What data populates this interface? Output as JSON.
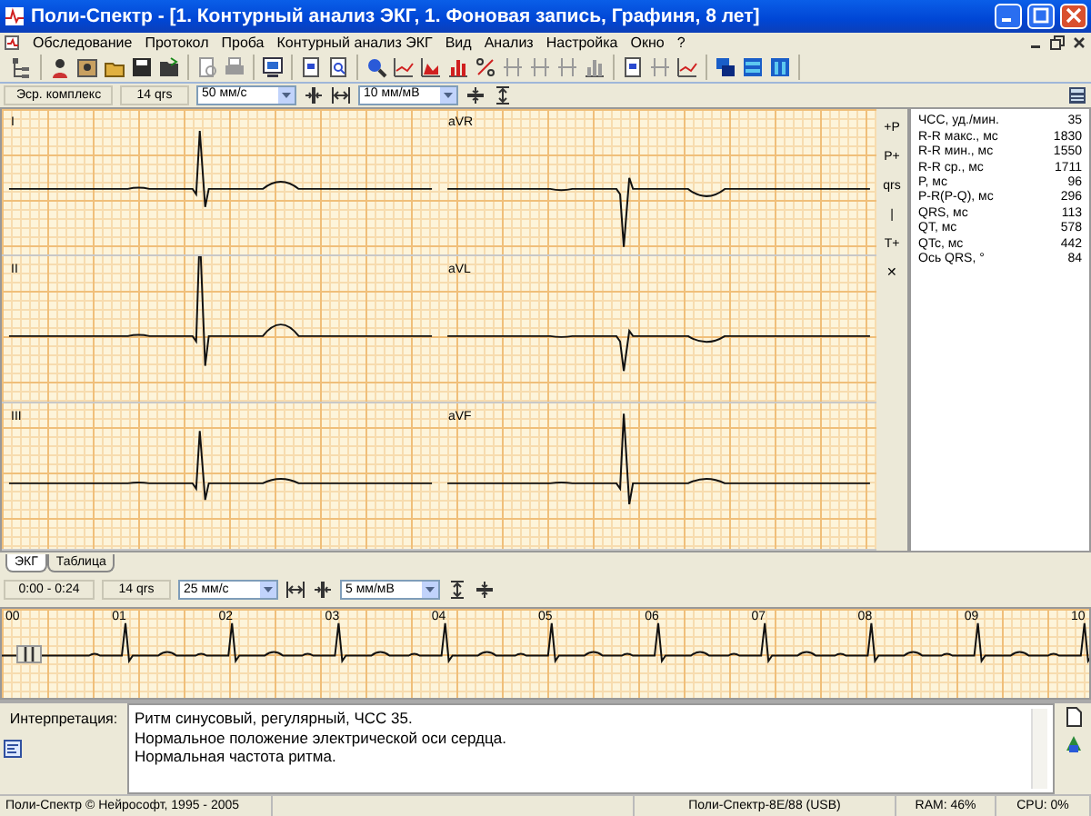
{
  "window": {
    "title": "Поли-Спектр - [1. Контурный анализ ЭКГ, 1. Фоновая запись, Графиня, 8 лет]"
  },
  "menu": [
    "Обследование",
    "Протокол",
    "Проба",
    "Контурный анализ ЭКГ",
    "Вид",
    "Анализ",
    "Настройка",
    "Окно",
    "?"
  ],
  "toolbar": [
    [
      {
        "kind": "tree",
        "disabled": false
      }
    ],
    [
      {
        "kind": "person",
        "disabled": false
      },
      {
        "kind": "photo",
        "disabled": false
      },
      {
        "kind": "open",
        "disabled": false
      },
      {
        "kind": "save",
        "disabled": false
      },
      {
        "kind": "folder",
        "disabled": false
      }
    ],
    [
      {
        "kind": "preview",
        "disabled": true
      },
      {
        "kind": "print",
        "disabled": true
      }
    ],
    [
      {
        "kind": "monitor",
        "disabled": false
      }
    ],
    [
      {
        "kind": "doc",
        "disabled": false
      },
      {
        "kind": "docsearch",
        "disabled": false
      }
    ],
    [
      {
        "kind": "search",
        "disabled": false
      },
      {
        "kind": "line",
        "disabled": false
      },
      {
        "kind": "area",
        "disabled": false
      },
      {
        "kind": "bar",
        "disabled": false
      },
      {
        "kind": "percent",
        "disabled": false
      },
      {
        "kind": "marker",
        "disabled": true
      },
      {
        "kind": "marker",
        "disabled": true
      },
      {
        "kind": "marker",
        "disabled": true
      },
      {
        "kind": "bar",
        "disabled": true
      }
    ],
    [
      {
        "kind": "doc",
        "disabled": false
      },
      {
        "kind": "marker",
        "disabled": true
      },
      {
        "kind": "line",
        "disabled": false
      }
    ],
    [
      {
        "kind": "cascade",
        "disabled": false
      },
      {
        "kind": "horizontal",
        "disabled": false
      },
      {
        "kind": "vertical",
        "disabled": false
      }
    ]
  ],
  "lead_toolbar": {
    "complex": "Эср. комплекс",
    "qrs_count": "14 qrs",
    "speed": "50 мм/с",
    "gain": "10 мм/мВ"
  },
  "leads": [
    {
      "name": "I"
    },
    {
      "name": "aVR"
    },
    {
      "name": "II"
    },
    {
      "name": "aVL"
    },
    {
      "name": "III"
    },
    {
      "name": "aVF"
    }
  ],
  "lead_tools": [
    "+P",
    "P+",
    "qrs",
    "|",
    "T+",
    "✕"
  ],
  "measurements": [
    {
      "label": "ЧСС, уд./мин.",
      "value": "35"
    },
    {
      "label": "R-R макс., мс",
      "value": "1830"
    },
    {
      "label": "R-R мин., мс",
      "value": "1550"
    },
    {
      "label": "R-R ср., мс",
      "value": "1711"
    },
    {
      "label": "P, мс",
      "value": "96"
    },
    {
      "label": "P-R(P-Q), мс",
      "value": "296"
    },
    {
      "label": "QRS, мс",
      "value": "113"
    },
    {
      "label": "QT, мс",
      "value": "578"
    },
    {
      "label": "QTc, мс",
      "value": "442"
    },
    {
      "label": "Ось QRS, °",
      "value": "84"
    }
  ],
  "tabs": [
    {
      "label": "ЭКГ",
      "selected": true
    },
    {
      "label": "Таблица",
      "selected": false
    }
  ],
  "rhythm_toolbar": {
    "range": "0:00 - 0:24",
    "qrs_count": "14 qrs",
    "speed": "25 мм/с",
    "gain": "5 мм/мВ"
  },
  "rhythm_strip": {
    "time_labels": [
      "00",
      "01",
      "02",
      "03",
      "04",
      "05",
      "06",
      "07",
      "08",
      "09",
      "10"
    ]
  },
  "interpretation": {
    "label": "Интерпретация:",
    "lines": [
      "Ритм синусовый, регулярный, ЧСС 35.",
      "Нормальное положение электрической оси сердца.",
      "Нормальная частота ритма."
    ]
  },
  "status_bar": [
    "Поли-Спектр © Нейрософт, 1995 - 2005",
    "Поли-Спектр-8Е/88 (USB)",
    "RAM: 46%",
    "CPU: 0%"
  ]
}
